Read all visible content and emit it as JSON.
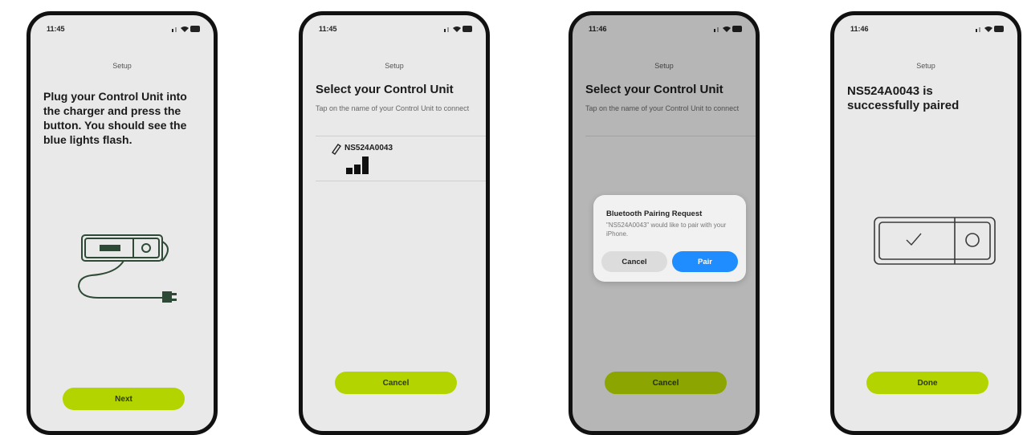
{
  "screens": [
    {
      "status_time": "11:45",
      "title": "Setup",
      "heading": "Plug your Control Unit into the charger and press the button. You should see the blue lights flash.",
      "button_label": "Next"
    },
    {
      "status_time": "11:45",
      "title": "Setup",
      "heading": "Select your Control Unit",
      "subtitle": "Tap on the name of your Control Unit to connect",
      "device_name": "NS524A0043",
      "button_label": "Cancel"
    },
    {
      "status_time": "11:46",
      "title": "Setup",
      "heading": "Select your Control Unit",
      "subtitle": "Tap on the name of your Control Unit to connect",
      "alert": {
        "title": "Bluetooth Pairing Request",
        "message": "\"NS524A0043\" would like to pair with your iPhone.",
        "cancel_label": "Cancel",
        "pair_label": "Pair"
      },
      "button_label": "Cancel"
    },
    {
      "status_time": "11:46",
      "title": "Setup",
      "heading": "NS524A0043 is successfully paired",
      "button_label": "Done"
    }
  ],
  "colors": {
    "accent": "#b4d400",
    "pair_blue": "#1f8cff",
    "illustration": "#2e4a36"
  },
  "icons": [
    "location-arrow-icon",
    "signal-icon",
    "wifi-icon",
    "battery-icon",
    "bluetooth-device-icon",
    "signal-bars-icon",
    "charger-illustration-icon",
    "paired-device-illustration-icon"
  ]
}
